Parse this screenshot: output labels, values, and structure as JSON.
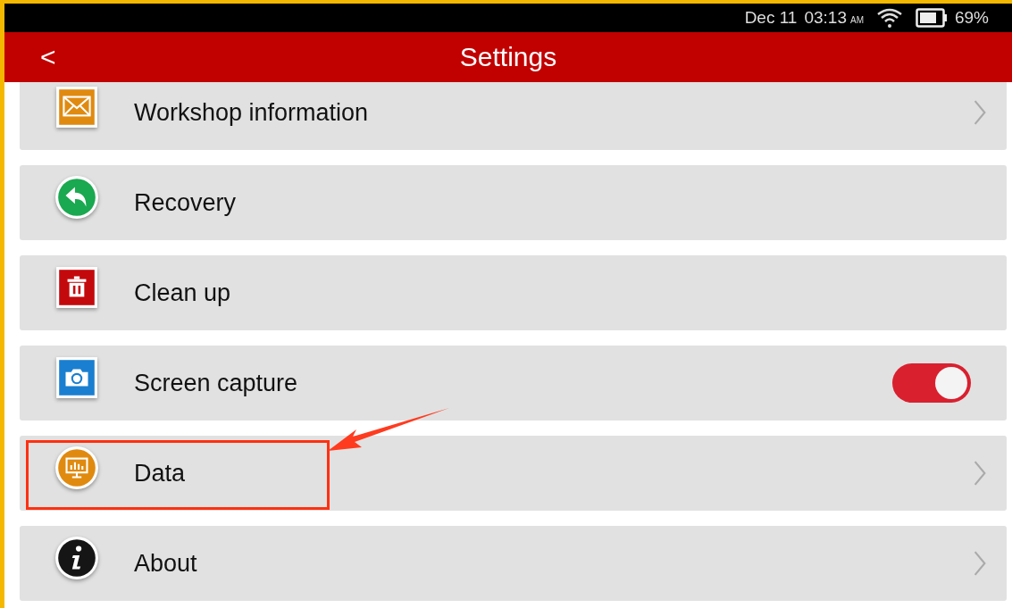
{
  "status_bar": {
    "date": "Dec 11",
    "time": "03:13",
    "meridiem": "AM",
    "battery": "69%"
  },
  "header": {
    "title": "Settings",
    "back": "<"
  },
  "items": [
    {
      "label": "Workshop information",
      "kind": "chevron",
      "highlighted": false
    },
    {
      "label": "Recovery",
      "kind": "plain",
      "highlighted": false
    },
    {
      "label": "Clean up",
      "kind": "plain",
      "highlighted": false
    },
    {
      "label": "Screen capture",
      "kind": "toggle",
      "on": true,
      "highlighted": false
    },
    {
      "label": "Data",
      "kind": "chevron",
      "highlighted": true
    },
    {
      "label": "About",
      "kind": "chevron",
      "highlighted": false
    }
  ]
}
